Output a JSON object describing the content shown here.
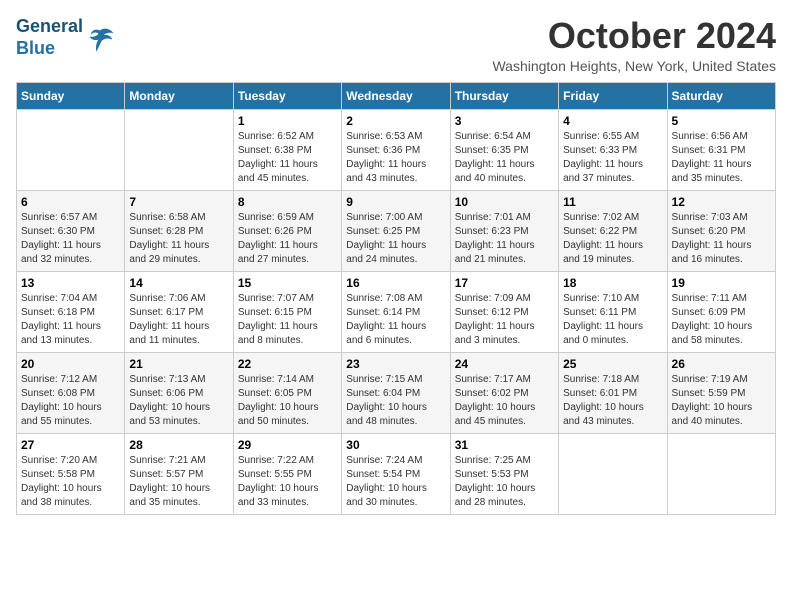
{
  "header": {
    "logo_line1": "General",
    "logo_line2": "Blue",
    "month": "October 2024",
    "location": "Washington Heights, New York, United States"
  },
  "weekdays": [
    "Sunday",
    "Monday",
    "Tuesday",
    "Wednesday",
    "Thursday",
    "Friday",
    "Saturday"
  ],
  "weeks": [
    [
      {
        "day": "",
        "info": ""
      },
      {
        "day": "",
        "info": ""
      },
      {
        "day": "1",
        "info": "Sunrise: 6:52 AM\nSunset: 6:38 PM\nDaylight: 11 hours\nand 45 minutes."
      },
      {
        "day": "2",
        "info": "Sunrise: 6:53 AM\nSunset: 6:36 PM\nDaylight: 11 hours\nand 43 minutes."
      },
      {
        "day": "3",
        "info": "Sunrise: 6:54 AM\nSunset: 6:35 PM\nDaylight: 11 hours\nand 40 minutes."
      },
      {
        "day": "4",
        "info": "Sunrise: 6:55 AM\nSunset: 6:33 PM\nDaylight: 11 hours\nand 37 minutes."
      },
      {
        "day": "5",
        "info": "Sunrise: 6:56 AM\nSunset: 6:31 PM\nDaylight: 11 hours\nand 35 minutes."
      }
    ],
    [
      {
        "day": "6",
        "info": "Sunrise: 6:57 AM\nSunset: 6:30 PM\nDaylight: 11 hours\nand 32 minutes."
      },
      {
        "day": "7",
        "info": "Sunrise: 6:58 AM\nSunset: 6:28 PM\nDaylight: 11 hours\nand 29 minutes."
      },
      {
        "day": "8",
        "info": "Sunrise: 6:59 AM\nSunset: 6:26 PM\nDaylight: 11 hours\nand 27 minutes."
      },
      {
        "day": "9",
        "info": "Sunrise: 7:00 AM\nSunset: 6:25 PM\nDaylight: 11 hours\nand 24 minutes."
      },
      {
        "day": "10",
        "info": "Sunrise: 7:01 AM\nSunset: 6:23 PM\nDaylight: 11 hours\nand 21 minutes."
      },
      {
        "day": "11",
        "info": "Sunrise: 7:02 AM\nSunset: 6:22 PM\nDaylight: 11 hours\nand 19 minutes."
      },
      {
        "day": "12",
        "info": "Sunrise: 7:03 AM\nSunset: 6:20 PM\nDaylight: 11 hours\nand 16 minutes."
      }
    ],
    [
      {
        "day": "13",
        "info": "Sunrise: 7:04 AM\nSunset: 6:18 PM\nDaylight: 11 hours\nand 13 minutes."
      },
      {
        "day": "14",
        "info": "Sunrise: 7:06 AM\nSunset: 6:17 PM\nDaylight: 11 hours\nand 11 minutes."
      },
      {
        "day": "15",
        "info": "Sunrise: 7:07 AM\nSunset: 6:15 PM\nDaylight: 11 hours\nand 8 minutes."
      },
      {
        "day": "16",
        "info": "Sunrise: 7:08 AM\nSunset: 6:14 PM\nDaylight: 11 hours\nand 6 minutes."
      },
      {
        "day": "17",
        "info": "Sunrise: 7:09 AM\nSunset: 6:12 PM\nDaylight: 11 hours\nand 3 minutes."
      },
      {
        "day": "18",
        "info": "Sunrise: 7:10 AM\nSunset: 6:11 PM\nDaylight: 11 hours\nand 0 minutes."
      },
      {
        "day": "19",
        "info": "Sunrise: 7:11 AM\nSunset: 6:09 PM\nDaylight: 10 hours\nand 58 minutes."
      }
    ],
    [
      {
        "day": "20",
        "info": "Sunrise: 7:12 AM\nSunset: 6:08 PM\nDaylight: 10 hours\nand 55 minutes."
      },
      {
        "day": "21",
        "info": "Sunrise: 7:13 AM\nSunset: 6:06 PM\nDaylight: 10 hours\nand 53 minutes."
      },
      {
        "day": "22",
        "info": "Sunrise: 7:14 AM\nSunset: 6:05 PM\nDaylight: 10 hours\nand 50 minutes."
      },
      {
        "day": "23",
        "info": "Sunrise: 7:15 AM\nSunset: 6:04 PM\nDaylight: 10 hours\nand 48 minutes."
      },
      {
        "day": "24",
        "info": "Sunrise: 7:17 AM\nSunset: 6:02 PM\nDaylight: 10 hours\nand 45 minutes."
      },
      {
        "day": "25",
        "info": "Sunrise: 7:18 AM\nSunset: 6:01 PM\nDaylight: 10 hours\nand 43 minutes."
      },
      {
        "day": "26",
        "info": "Sunrise: 7:19 AM\nSunset: 5:59 PM\nDaylight: 10 hours\nand 40 minutes."
      }
    ],
    [
      {
        "day": "27",
        "info": "Sunrise: 7:20 AM\nSunset: 5:58 PM\nDaylight: 10 hours\nand 38 minutes."
      },
      {
        "day": "28",
        "info": "Sunrise: 7:21 AM\nSunset: 5:57 PM\nDaylight: 10 hours\nand 35 minutes."
      },
      {
        "day": "29",
        "info": "Sunrise: 7:22 AM\nSunset: 5:55 PM\nDaylight: 10 hours\nand 33 minutes."
      },
      {
        "day": "30",
        "info": "Sunrise: 7:24 AM\nSunset: 5:54 PM\nDaylight: 10 hours\nand 30 minutes."
      },
      {
        "day": "31",
        "info": "Sunrise: 7:25 AM\nSunset: 5:53 PM\nDaylight: 10 hours\nand 28 minutes."
      },
      {
        "day": "",
        "info": ""
      },
      {
        "day": "",
        "info": ""
      }
    ]
  ]
}
